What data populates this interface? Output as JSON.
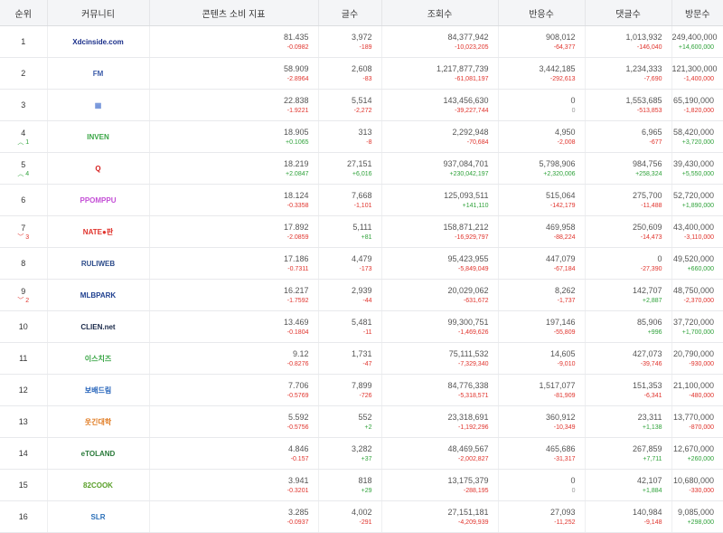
{
  "headers": [
    "순위",
    "커뮤니티",
    "콘텐츠 소비 지표",
    "글수",
    "조회수",
    "반응수",
    "댓글수",
    "방문수"
  ],
  "rows": [
    {
      "rank": "1",
      "change": "",
      "dir": "",
      "logo": "Xdcinside.com",
      "logo_color": "#1a2f8a",
      "logo_icon": "dcinside-logo",
      "vals": [
        "81.435",
        "3,972",
        "84,377,942",
        "908,012",
        "1,013,932",
        "249,400,000"
      ],
      "deltas": [
        "-0.0982",
        "-189",
        "-10,023,205",
        "-64,377",
        "-146,040",
        "+14,600,000"
      ]
    },
    {
      "rank": "2",
      "change": "",
      "dir": "",
      "logo": "FM",
      "logo_color": "#3b5ba9",
      "logo_icon": "fmkorea-logo",
      "vals": [
        "58.909",
        "2,608",
        "1,217,877,739",
        "3,442,185",
        "1,234,333",
        "121,300,000"
      ],
      "deltas": [
        "-2.8964",
        "-83",
        "-61,081,197",
        "-292,613",
        "-7,690",
        "-1,400,000"
      ]
    },
    {
      "rank": "3",
      "change": "",
      "dir": "",
      "logo": "▦",
      "logo_color": "#6d8fd8",
      "logo_icon": "grid-logo",
      "vals": [
        "22.838",
        "5,514",
        "143,456,630",
        "0",
        "1,553,685",
        "65,190,000"
      ],
      "deltas": [
        "-1.9221",
        "-2,272",
        "-39,227,744",
        "0",
        "-513,853",
        "-1,820,000"
      ]
    },
    {
      "rank": "4",
      "change": "1",
      "dir": "up",
      "logo": "INVEN",
      "logo_color": "#3aa646",
      "logo_icon": "inven-logo",
      "vals": [
        "18.905",
        "313",
        "2,292,948",
        "4,950",
        "6,965",
        "58,420,000"
      ],
      "deltas": [
        "+0.1065",
        "-8",
        "-70,684",
        "-2,008",
        "-677",
        "+3,720,000"
      ]
    },
    {
      "rank": "5",
      "change": "4",
      "dir": "up",
      "logo": "Q",
      "logo_color": "#d62020",
      "logo_icon": "circle-q-logo",
      "vals": [
        "18.219",
        "27,151",
        "937,084,701",
        "5,798,906",
        "984,756",
        "39,430,000"
      ],
      "deltas": [
        "+2.0847",
        "+6,016",
        "+230,042,197",
        "+2,320,006",
        "+258,324",
        "+5,550,000"
      ]
    },
    {
      "rank": "6",
      "change": "",
      "dir": "",
      "logo": "PPOMPPU",
      "logo_color": "#c44fd6",
      "logo_icon": "ppomppu-logo",
      "vals": [
        "18.124",
        "7,668",
        "125,093,511",
        "515,064",
        "275,700",
        "52,720,000"
      ],
      "deltas": [
        "-0.3358",
        "-1,101",
        "+141,110",
        "-142,179",
        "-11,488",
        "+1,890,000"
      ]
    },
    {
      "rank": "7",
      "change": "3",
      "dir": "down",
      "logo": "NATE●판",
      "logo_color": "#e0332c",
      "logo_icon": "nate-logo",
      "vals": [
        "17.892",
        "5,111",
        "158,871,212",
        "469,958",
        "250,609",
        "43,400,000"
      ],
      "deltas": [
        "-2.0859",
        "+81",
        "-16,929,797",
        "-88,224",
        "-14,473",
        "-3,110,000"
      ]
    },
    {
      "rank": "8",
      "change": "",
      "dir": "",
      "logo": "RULIWEB",
      "logo_color": "#2c4b8a",
      "logo_icon": "ruliweb-logo",
      "vals": [
        "17.186",
        "4,479",
        "95,423,955",
        "447,079",
        "0",
        "49,520,000"
      ],
      "deltas": [
        "-0.7311",
        "-173",
        "-5,849,049",
        "-67,184",
        "-27,390",
        "+660,000"
      ]
    },
    {
      "rank": "9",
      "change": "2",
      "dir": "down",
      "logo": "MLBPARK",
      "logo_color": "#1e3f8f",
      "logo_icon": "mlbpark-logo",
      "vals": [
        "16.217",
        "2,939",
        "20,029,062",
        "8,262",
        "142,707",
        "48,750,000"
      ],
      "deltas": [
        "-1.7592",
        "-44",
        "-631,672",
        "-1,737",
        "+2,887",
        "-2,370,000"
      ]
    },
    {
      "rank": "10",
      "change": "",
      "dir": "",
      "logo": "CLIEN.net",
      "logo_color": "#1b2a4a",
      "logo_icon": "clien-logo",
      "vals": [
        "13.469",
        "5,481",
        "99,300,751",
        "197,146",
        "85,906",
        "37,720,000"
      ],
      "deltas": [
        "-0.1804",
        "-11",
        "-1,469,626",
        "-55,809",
        "+996",
        "+1,700,000"
      ]
    },
    {
      "rank": "11",
      "change": "",
      "dir": "",
      "logo": "이스치즈",
      "logo_color": "#3aa646",
      "logo_icon": "green-logo",
      "vals": [
        "9.12",
        "1,731",
        "75,111,532",
        "14,605",
        "427,073",
        "20,790,000"
      ],
      "deltas": [
        "-0.8276",
        "-47",
        "-7,329,340",
        "-9,010",
        "-39,746",
        "-930,000"
      ]
    },
    {
      "rank": "12",
      "change": "",
      "dir": "",
      "logo": "보배드림",
      "logo_color": "#1f5fb8",
      "logo_icon": "bobaedream-logo",
      "vals": [
        "7.706",
        "7,899",
        "84,776,338",
        "1,517,077",
        "151,353",
        "21,100,000"
      ],
      "deltas": [
        "-0.5769",
        "-726",
        "-5,318,571",
        "-81,909",
        "-6,341",
        "-480,000"
      ]
    },
    {
      "rank": "13",
      "change": "",
      "dir": "",
      "logo": "웃긴대학",
      "logo_color": "#e07a20",
      "logo_icon": "humoruniv-logo",
      "vals": [
        "5.592",
        "552",
        "23,318,691",
        "360,912",
        "23,311",
        "13,770,000"
      ],
      "deltas": [
        "-0.5756",
        "+2",
        "-1,192,296",
        "-10,349",
        "+1,138",
        "-870,000"
      ]
    },
    {
      "rank": "14",
      "change": "",
      "dir": "",
      "logo": "eTOLAND",
      "logo_color": "#2a7a3a",
      "logo_icon": "etoland-logo",
      "vals": [
        "4.846",
        "3,282",
        "48,469,567",
        "465,686",
        "267,859",
        "12,670,000"
      ],
      "deltas": [
        "-0.157",
        "+37",
        "-2,002,827",
        "-31,317",
        "+7,711",
        "+260,000"
      ]
    },
    {
      "rank": "15",
      "change": "",
      "dir": "",
      "logo": "82COOK",
      "logo_color": "#5aa02a",
      "logo_icon": "82cook-logo",
      "vals": [
        "3.941",
        "818",
        "13,175,379",
        "0",
        "42,107",
        "10,680,000"
      ],
      "deltas": [
        "-0.3201",
        "+29",
        "-288,195",
        "0",
        "+1,884",
        "-330,000"
      ]
    },
    {
      "rank": "16",
      "change": "",
      "dir": "",
      "logo": "SLR",
      "logo_color": "#2a6fb8",
      "logo_icon": "slr-logo",
      "vals": [
        "3.285",
        "4,002",
        "27,151,181",
        "27,093",
        "140,984",
        "9,085,000"
      ],
      "deltas": [
        "-0.0937",
        "-291",
        "-4,209,939",
        "-11,252",
        "-9,148",
        "+298,000"
      ]
    }
  ]
}
